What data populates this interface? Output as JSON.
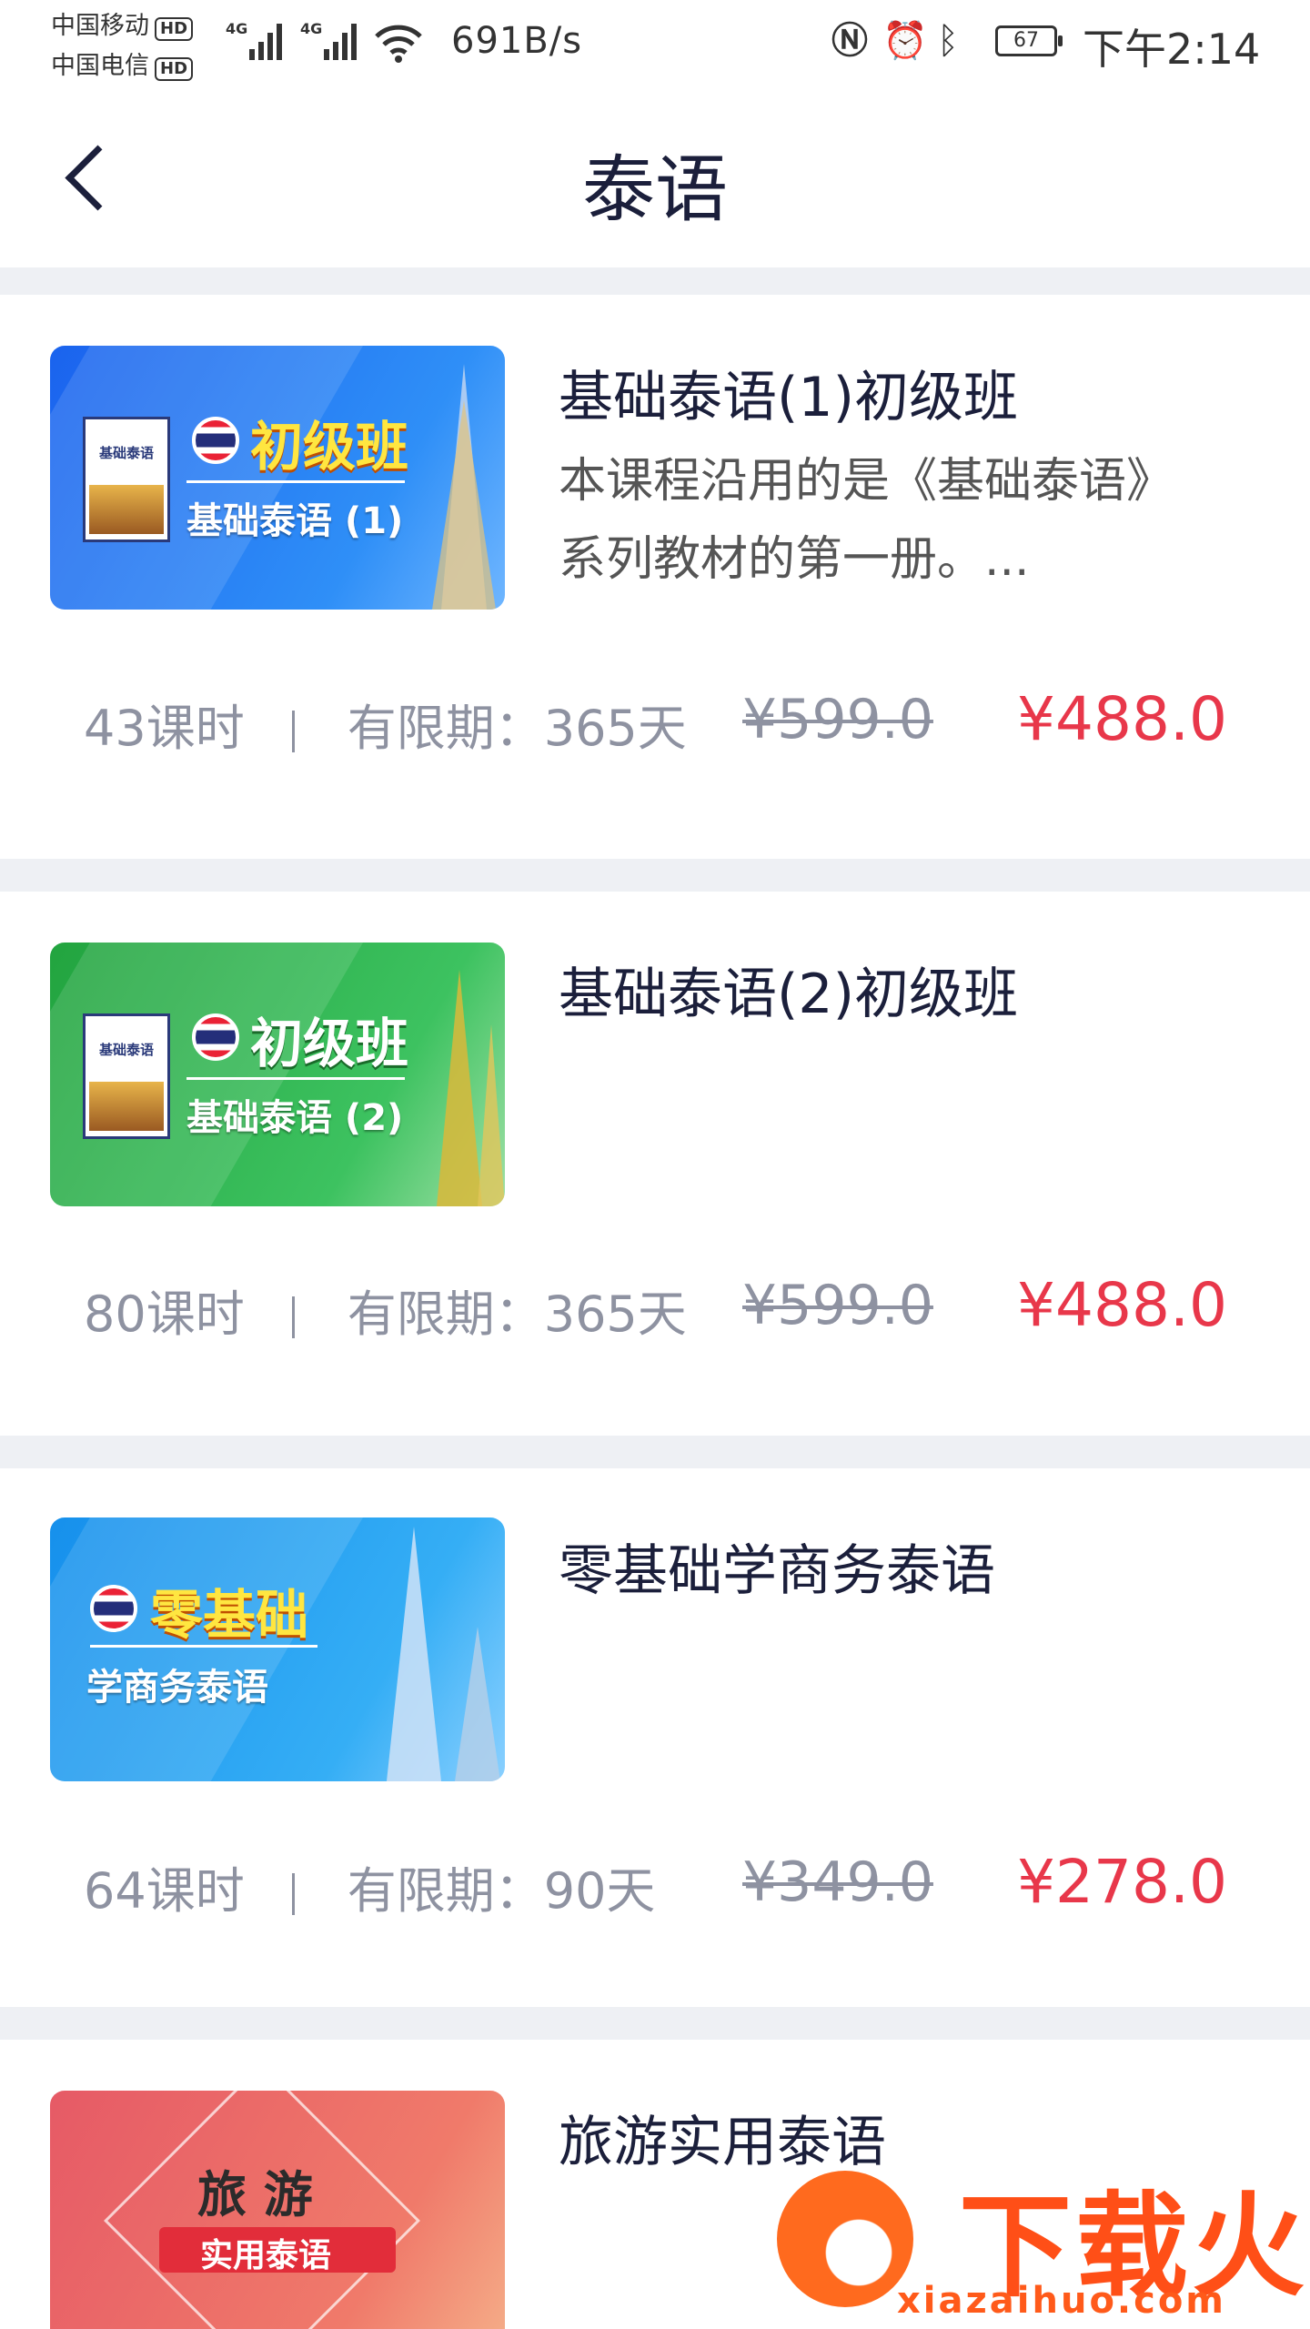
{
  "status_bar": {
    "carrier1": "中国移动",
    "carrier2": "中国电信",
    "hd": "HD",
    "network": "4G",
    "net_speed": "691B/s",
    "battery": "67",
    "time": "下午2:14",
    "icons": [
      "nfc-icon",
      "alarm-icon",
      "bluetooth-icon",
      "wifi-icon",
      "signal-icon"
    ]
  },
  "nav": {
    "title": "泰语",
    "back_icon": "chevron-left-icon"
  },
  "courses": [
    {
      "title": "基础泰语(1)初级班",
      "desc": "  本课程沿用的是《基础泰语》系列教材的第一册。...",
      "hours": "43课时",
      "validity": "有限期：365天",
      "orig_price": "¥599.0",
      "price": "¥488.0",
      "thumb": {
        "big": "初级班",
        "small": "基础泰语 (1)",
        "book_title": "基础泰语",
        "bg": "#1f6ff0"
      }
    },
    {
      "title": "基础泰语(2)初级班",
      "desc": "",
      "hours": "80课时",
      "validity": "有限期：365天",
      "orig_price": "¥599.0",
      "price": "¥488.0",
      "thumb": {
        "big": "初级班",
        "small": "基础泰语 (2)",
        "book_title": "基础泰语",
        "bg": "#2bb34a"
      }
    },
    {
      "title": "零基础学商务泰语",
      "desc": "",
      "hours": "64课时",
      "validity": "有限期：90天",
      "orig_price": "¥349.0",
      "price": "¥278.0",
      "thumb": {
        "big": "零基础",
        "small": "学商务泰语",
        "bg": "#1e9af0"
      }
    },
    {
      "title": "旅游实用泰语",
      "thumb": {
        "big": "旅 游",
        "small": "实用泰语",
        "bg": "#e8626a"
      }
    }
  ],
  "watermark": {
    "brand": "下载火",
    "url": "xiazaihuo.com"
  },
  "colors": {
    "price_red": "#e8374a",
    "gray_text": "#8e92a1",
    "separator": "#eef0f4",
    "title_navy": "#1b1f3b"
  }
}
